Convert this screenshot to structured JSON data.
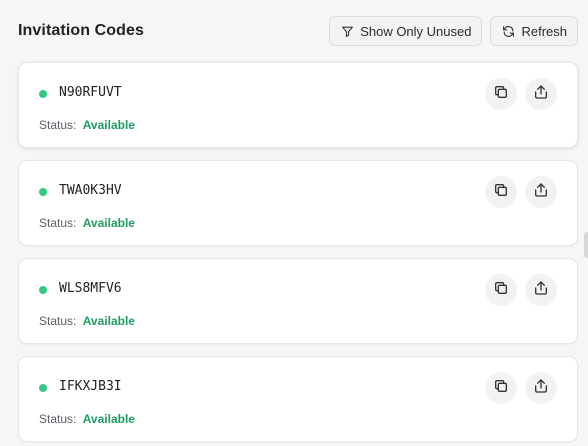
{
  "header": {
    "title": "Invitation Codes",
    "filter_label": "Show Only Unused",
    "refresh_label": "Refresh"
  },
  "status_label": "Status:",
  "codes": [
    {
      "code": "N90RFUVT",
      "status": "Available"
    },
    {
      "code": "TWA0K3HV",
      "status": "Available"
    },
    {
      "code": "WLS8MFV6",
      "status": "Available"
    },
    {
      "code": "IFKXJB3I",
      "status": "Available"
    }
  ],
  "colors": {
    "available_dot": "#34c986",
    "available_text": "#1f9d62"
  },
  "icons": {
    "filter": "filter-icon",
    "refresh": "refresh-icon",
    "copy": "copy-icon",
    "share": "share-icon"
  }
}
